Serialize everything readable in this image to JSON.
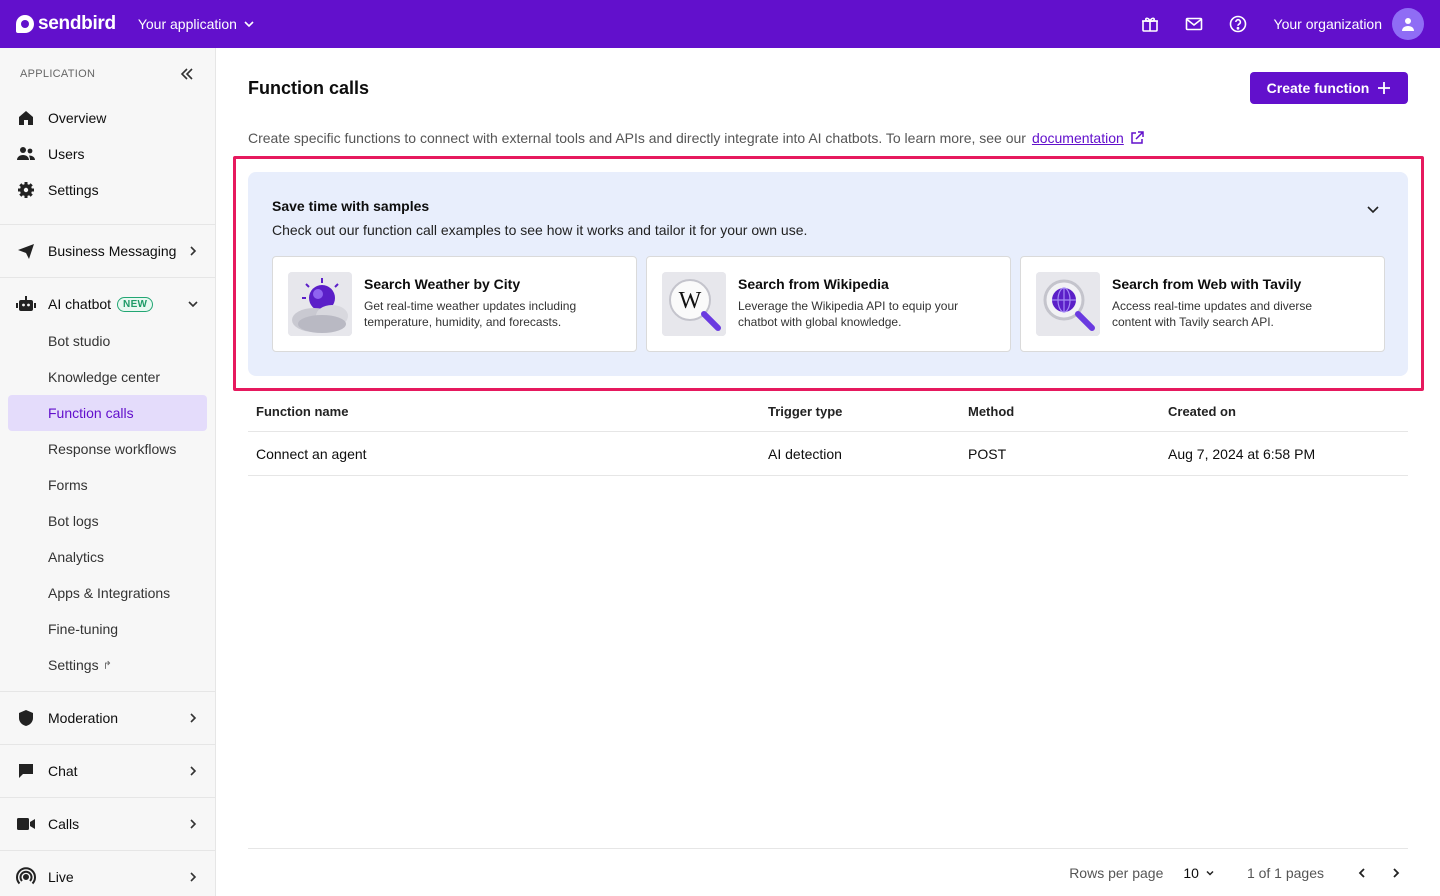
{
  "topbar": {
    "logo": "sendbird",
    "app_name": "Your application",
    "org_name": "Your organization",
    "icons": [
      "gift-icon",
      "mail-icon",
      "help-icon",
      "user-icon"
    ]
  },
  "sidebar": {
    "section_label": "APPLICATION",
    "items": [
      {
        "label": "Overview",
        "icon": "home-icon"
      },
      {
        "label": "Users",
        "icon": "users-icon"
      },
      {
        "label": "Settings",
        "icon": "gear-icon"
      }
    ],
    "business_messaging": "Business Messaging",
    "ai_chatbot": "AI chatbot",
    "new_badge": "NEW",
    "ai_sub": [
      "Bot studio",
      "Knowledge center",
      "Function calls",
      "Response workflows",
      "Forms",
      "Bot logs",
      "Analytics",
      "Apps & Integrations",
      "Fine-tuning",
      "Settings"
    ],
    "moderation": "Moderation",
    "chat": "Chat",
    "calls": "Calls",
    "live": "Live"
  },
  "main": {
    "title": "Function calls",
    "create_button": "Create function",
    "description": "Create specific functions to connect with external tools and APIs and directly integrate into AI chatbots. To learn more, see our",
    "doc_link": "documentation",
    "samples": {
      "title": "Save time with samples",
      "subtitle": "Check out our function call examples to see how it works and tailor it for your own use.",
      "cards": [
        {
          "title": "Search Weather by City",
          "desc1": "Get real-time weather updates including",
          "desc2": "temperature, humidity, and forecasts."
        },
        {
          "title": "Search from Wikipedia",
          "desc1": "Leverage the Wikipedia API to equip your",
          "desc2": "chatbot with global knowledge."
        },
        {
          "title": "Search from Web with Tavily",
          "desc1": "Access real-time updates and diverse",
          "desc2": "content with Tavily search API."
        }
      ]
    },
    "table": {
      "headers": [
        "Function name",
        "Trigger type",
        "Method",
        "Created on"
      ],
      "rows": [
        [
          "Connect an agent",
          "AI detection",
          "POST",
          "Aug 7, 2024 at 6:58 PM"
        ]
      ]
    },
    "pager": {
      "rows_label": "Rows per page",
      "rows_value": "10",
      "page_info": "1 of 1 pages"
    }
  },
  "colors": {
    "brand": "#6210cc",
    "highlight": "#e6195e",
    "samples_bg": "#e8eefc",
    "active_bg": "#e4dcfb"
  }
}
